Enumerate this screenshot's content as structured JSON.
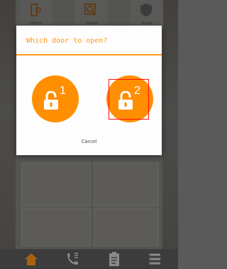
{
  "top_bar": {
    "items": [
      {
        "label": "Unlock",
        "icon": "unlock-door-icon"
      },
      {
        "label": "Search",
        "icon": "search-icon"
      },
      {
        "label": "Guard",
        "icon": "shield-icon"
      }
    ]
  },
  "dialog": {
    "title": "Which door to open?",
    "doors": [
      {
        "number": "1",
        "icon": "padlock-icon"
      },
      {
        "number": "2",
        "icon": "padlock-icon"
      }
    ],
    "cancel_label": "Cancel"
  },
  "bottom_nav": {
    "items": [
      {
        "icon": "home-icon",
        "active": true
      },
      {
        "icon": "phone-call-icon",
        "active": false
      },
      {
        "icon": "clipboard-icon",
        "active": false
      },
      {
        "icon": "list-menu-icon",
        "active": false
      }
    ]
  },
  "colors": {
    "accent": "#ff8e00",
    "title": "#ff9518",
    "selection": "#ff1010"
  }
}
